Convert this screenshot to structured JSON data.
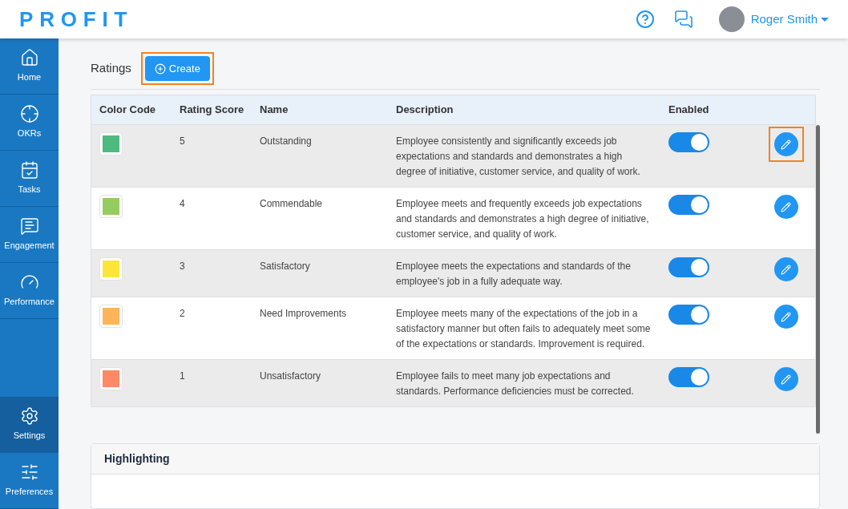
{
  "header": {
    "logo": "PROFIT",
    "user": "Roger Smith"
  },
  "sidebar": {
    "items": [
      {
        "label": "Home",
        "kind": "home",
        "selected": false
      },
      {
        "label": "OKRs",
        "kind": "target",
        "selected": false
      },
      {
        "label": "Tasks",
        "kind": "tasks",
        "selected": false
      },
      {
        "label": "Engagement",
        "kind": "chat",
        "selected": false
      },
      {
        "label": "Performance",
        "kind": "gauge",
        "selected": false
      }
    ],
    "bottom_items": [
      {
        "label": "Settings",
        "kind": "settings",
        "selected": true
      },
      {
        "label": "Preferences",
        "kind": "sliders",
        "selected": false
      }
    ]
  },
  "ratings": {
    "title": "Ratings",
    "create_button": {
      "label": "Create",
      "highlighted": true
    },
    "columns": [
      "Color Code",
      "Rating Score",
      "Name",
      "Description",
      "Enabled"
    ],
    "rows": [
      {
        "color": "#4dbb7f",
        "score": "5",
        "name": "Outstanding",
        "description": "Employee consistently and significantly exceeds job expectations and standards and demonstrates a high degree of initiative, customer service, and quality of work.",
        "enabled": true,
        "edit_highlighted": true
      },
      {
        "color": "#96cc5e",
        "score": "4",
        "name": "Commendable",
        "description": "Employee meets and frequently exceeds job expectations and standards and demonstrates a high degree of initiative, customer service, and quality of work.",
        "enabled": true,
        "edit_highlighted": false
      },
      {
        "color": "#fde53a",
        "score": "3",
        "name": "Satisfactory",
        "description": "Employee meets the expectations and standards of the employee's job in a fully adequate way.",
        "enabled": true,
        "edit_highlighted": false
      },
      {
        "color": "#fdb45a",
        "score": "2",
        "name": "Need Improvements",
        "description": "Employee meets many of the expectations of the job in a satisfactory manner but often fails to adequately meet some of the expectations or standards. Improvement is required.",
        "enabled": true,
        "edit_highlighted": false
      },
      {
        "color": "#fd8a64",
        "score": "1",
        "name": "Unsatisfactory",
        "description": "Employee fails to meet many job expectations and standards. Performance deficiencies must be corrected.",
        "enabled": true,
        "edit_highlighted": false
      }
    ]
  },
  "highlighting": {
    "title": "Highlighting"
  }
}
